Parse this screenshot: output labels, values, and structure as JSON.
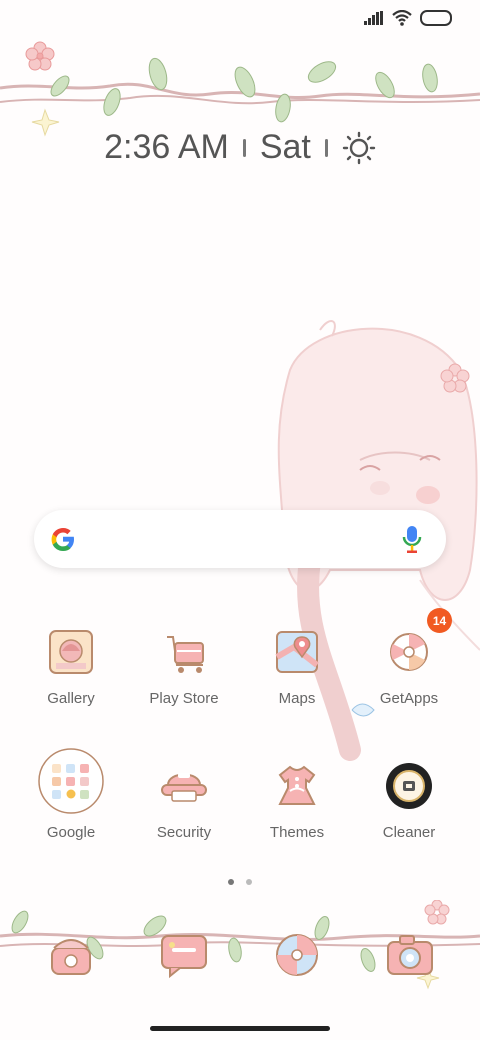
{
  "status_bar": {
    "signal_icon": "signal-icon",
    "wifi_icon": "wifi-icon",
    "battery_icon": "battery-icon"
  },
  "clock_widget": {
    "time": "2:36 AM",
    "day": "Sat",
    "weather_icon": "sun-icon"
  },
  "search_bar": {
    "logo": "google-logo",
    "mic_icon": "mic-icon"
  },
  "apps_row1": [
    {
      "label": "Gallery",
      "icon": "gallery-icon"
    },
    {
      "label": "Play Store",
      "icon": "play-store-icon"
    },
    {
      "label": "Maps",
      "icon": "maps-icon"
    },
    {
      "label": "GetApps",
      "icon": "getapps-icon",
      "badge": "14"
    }
  ],
  "apps_row2": [
    {
      "label": "Google",
      "icon": "google-folder-icon"
    },
    {
      "label": "Security",
      "icon": "security-icon"
    },
    {
      "label": "Themes",
      "icon": "themes-icon"
    },
    {
      "label": "Cleaner",
      "icon": "cleaner-icon"
    }
  ],
  "page_indicator": {
    "pages": 2,
    "current": 1
  },
  "dock": [
    {
      "icon": "phone-icon"
    },
    {
      "icon": "messages-icon"
    },
    {
      "icon": "browser-icon"
    },
    {
      "icon": "camera-icon"
    }
  ],
  "colors": {
    "badge": "#f15a22",
    "accent_pink": "#e89a9a",
    "vine_green": "#b9d3a9"
  }
}
